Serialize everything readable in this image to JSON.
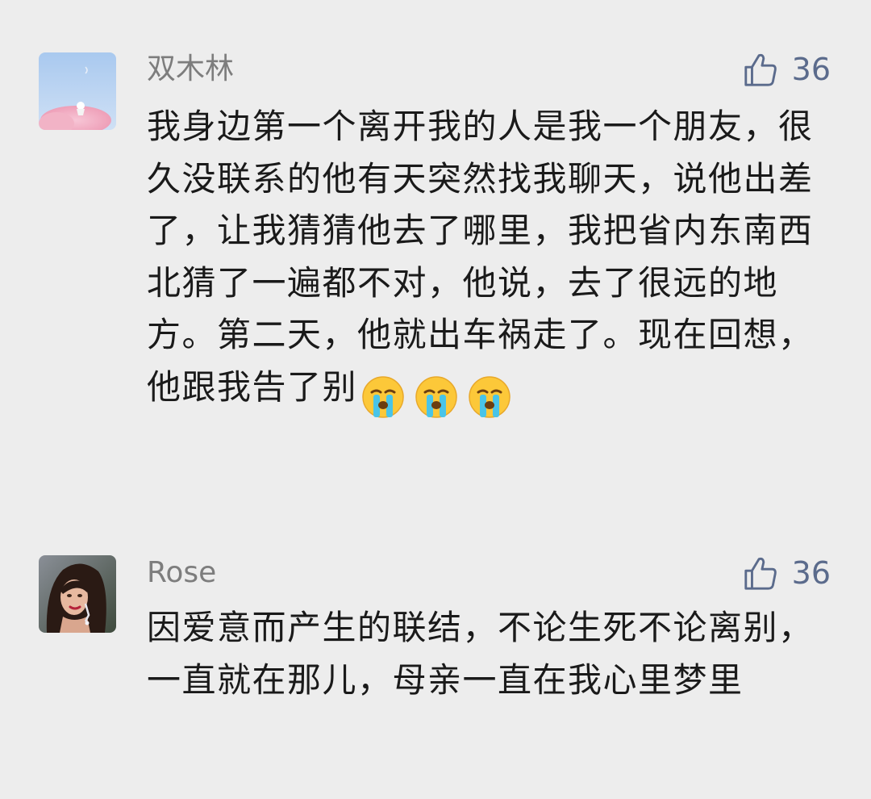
{
  "comments": [
    {
      "username": "双木林",
      "likes": "36",
      "avatar_icon": "sky-cloud-avatar",
      "text": "我身边第一个离开我的人是我一个朋友，很久没联系的他有天突然找我聊天，说他出差了，让我猜猜他去了哪里，我把省内东南西北猜了一遍都不对，他说，去了很远的地方。第二天，他就出车祸走了。现在回想，他跟我告了别",
      "emojis": [
        "crying-face-emoji",
        "crying-face-emoji",
        "crying-face-emoji"
      ]
    },
    {
      "username": "Rose",
      "likes": "36",
      "avatar_icon": "portrait-avatar",
      "text": "因爱意而产生的联结，不论生死不论离别，一直就在那儿，母亲一直在我心里梦里"
    }
  ],
  "colors": {
    "background": "#ededed",
    "username": "#7d7d7d",
    "like_accent": "#5b6b8c",
    "text": "#1a1a1a"
  }
}
